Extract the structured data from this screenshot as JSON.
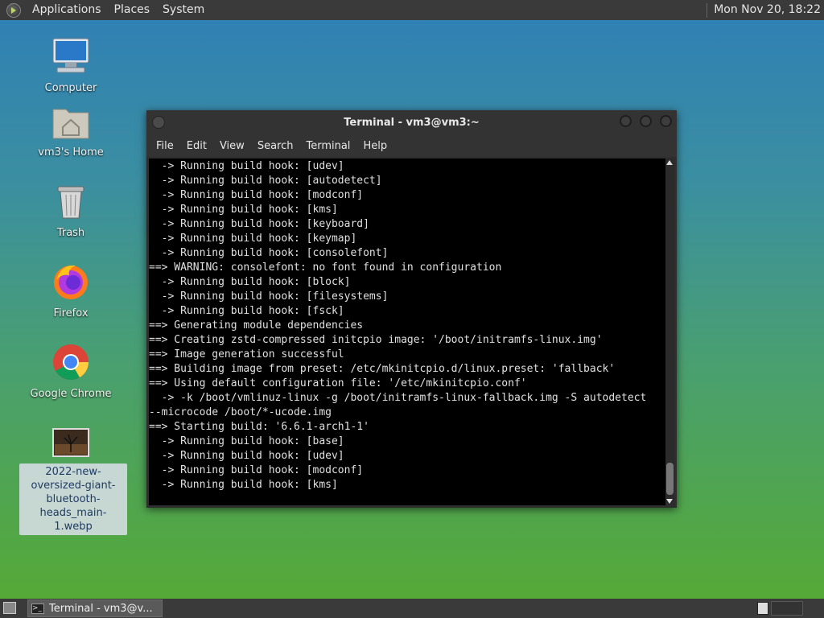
{
  "top_panel": {
    "menus": [
      "Applications",
      "Places",
      "System"
    ],
    "clock": "Mon Nov 20, 18:22"
  },
  "desktop_icons": [
    {
      "label": "Computer",
      "icon": "computer-icon"
    },
    {
      "label": "vm3's Home",
      "icon": "home-folder-icon"
    },
    {
      "label": "Trash",
      "icon": "trash-icon"
    },
    {
      "label": "Firefox",
      "icon": "firefox-icon"
    },
    {
      "label": "Google Chrome",
      "icon": "chrome-icon"
    },
    {
      "label": "2022-new-oversized-giant-bluetooth-heads_main-1.webp",
      "icon": "image-file-icon"
    }
  ],
  "terminal": {
    "title": "Terminal - vm3@vm3:~",
    "menus": [
      "File",
      "Edit",
      "View",
      "Search",
      "Terminal",
      "Help"
    ],
    "lines": [
      "  -> Running build hook: [udev]",
      "  -> Running build hook: [autodetect]",
      "  -> Running build hook: [modconf]",
      "  -> Running build hook: [kms]",
      "  -> Running build hook: [keyboard]",
      "  -> Running build hook: [keymap]",
      "  -> Running build hook: [consolefont]",
      "==> WARNING: consolefont: no font found in configuration",
      "  -> Running build hook: [block]",
      "  -> Running build hook: [filesystems]",
      "  -> Running build hook: [fsck]",
      "==> Generating module dependencies",
      "==> Creating zstd-compressed initcpio image: '/boot/initramfs-linux.img'",
      "==> Image generation successful",
      "==> Building image from preset: /etc/mkinitcpio.d/linux.preset: 'fallback'",
      "==> Using default configuration file: '/etc/mkinitcpio.conf'",
      "  -> -k /boot/vmlinuz-linux -g /boot/initramfs-linux-fallback.img -S autodetect",
      "--microcode /boot/*-ucode.img",
      "==> Starting build: '6.6.1-arch1-1'",
      "  -> Running build hook: [base]",
      "  -> Running build hook: [udev]",
      "  -> Running build hook: [modconf]",
      "  -> Running build hook: [kms]"
    ]
  },
  "taskbar": {
    "task_label": "Terminal - vm3@v..."
  }
}
